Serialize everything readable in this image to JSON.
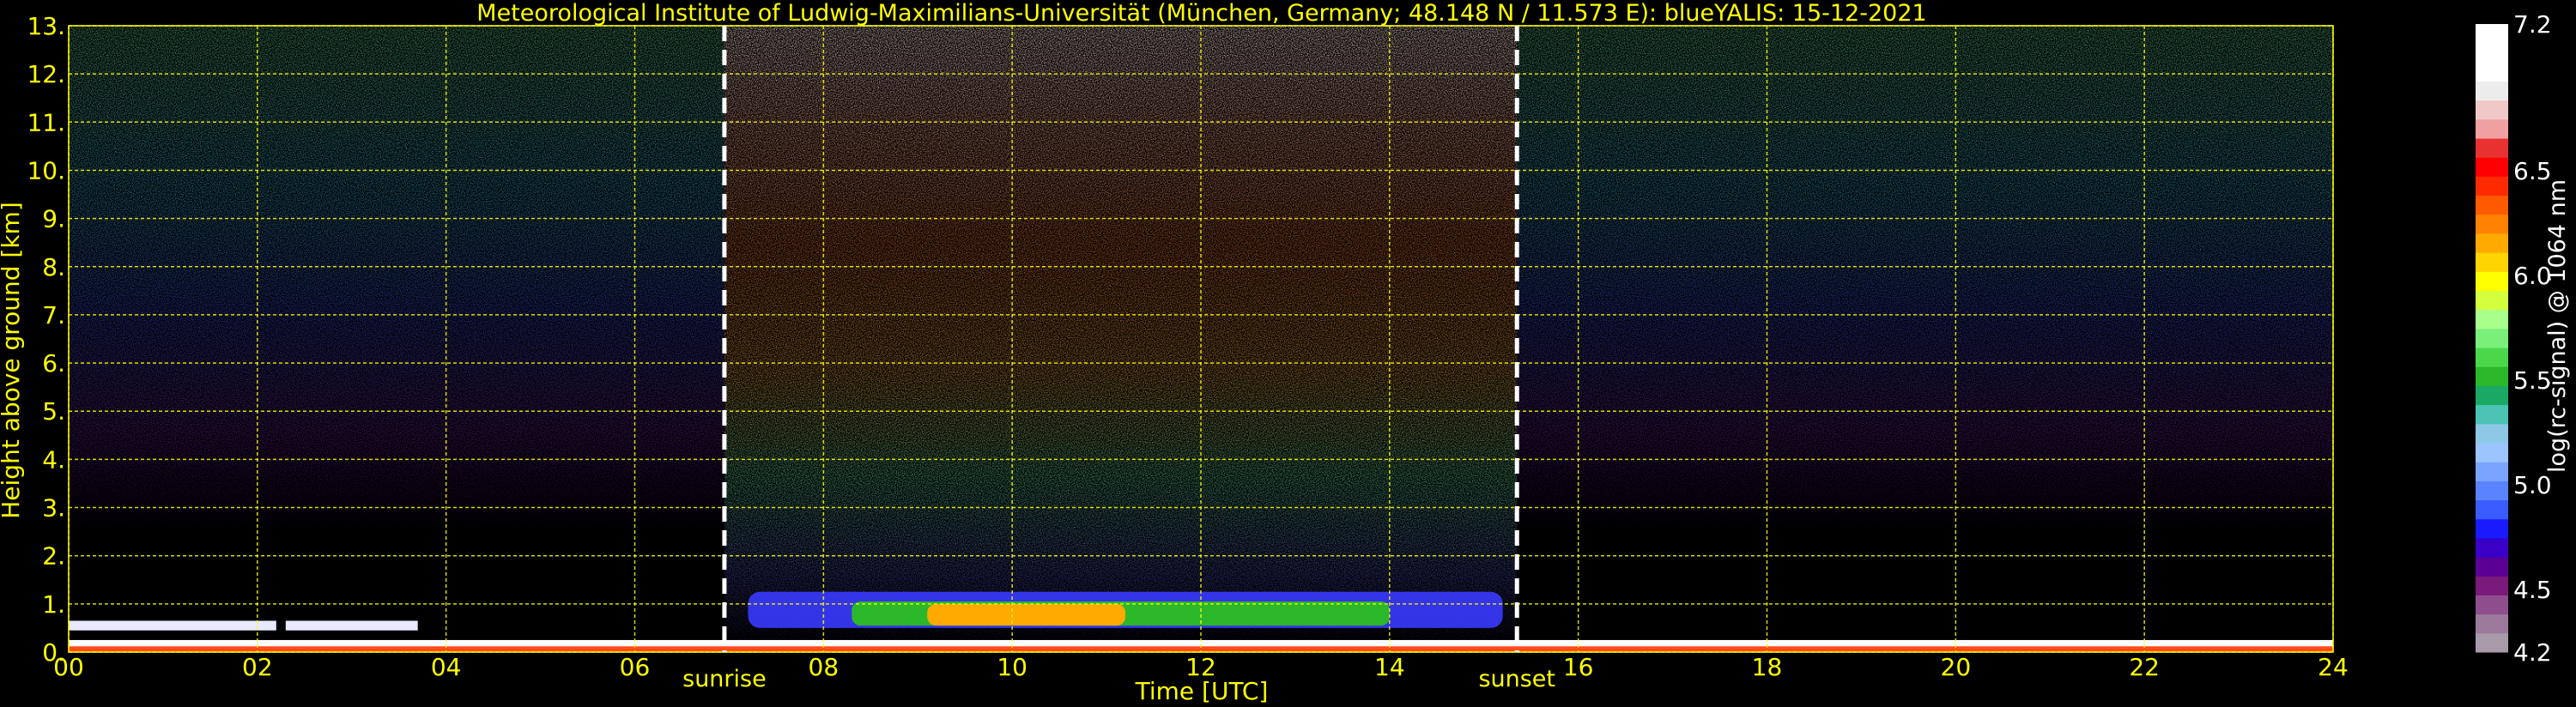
{
  "chart_data": {
    "type": "heatmap",
    "title": "Meteorological Institute of Ludwig-Maximilians-Universität (München, Germany; 48.148 N / 11.573 E):    blueYALIS: 15-12-2021",
    "xlabel": "Time [UTC]",
    "ylabel": "Height above ground [km]",
    "xlim": [
      0,
      24
    ],
    "ylim": [
      0,
      13
    ],
    "x_ticks": [
      "00",
      "02",
      "04",
      "06",
      "08",
      "10",
      "12",
      "14",
      "16",
      "18",
      "20",
      "22",
      "24"
    ],
    "y_ticks": [
      "0.",
      "1.",
      "2.",
      "3.",
      "4.",
      "5.",
      "6.",
      "7.",
      "8.",
      "9.",
      "10.",
      "11.",
      "12.",
      "13."
    ],
    "grid": true,
    "markers": [
      {
        "label": "sunrise",
        "x": 6.95
      },
      {
        "label": "sunset",
        "x": 15.35
      }
    ],
    "colorbar": {
      "label": "log(rc-signal) @ 1064 nm",
      "range": [
        4.2,
        7.2
      ],
      "ticks": [
        "7.2",
        "6.5",
        "6.0",
        "5.5",
        "5.0",
        "4.5",
        "4.2"
      ],
      "colors": [
        "#a89aa8",
        "#9c7a9c",
        "#8e4e8e",
        "#7a1a7a",
        "#5a0094",
        "#3a00c8",
        "#1a1aff",
        "#3a5cff",
        "#5a84ff",
        "#7aa4ff",
        "#9cc4ff",
        "#8cc8e6",
        "#4cc4b4",
        "#1aa864",
        "#2ab82a",
        "#4ad84a",
        "#7af07a",
        "#a8ff8c",
        "#d4ff3c",
        "#ffff00",
        "#ffd400",
        "#ffaa00",
        "#ff8200",
        "#ff5a00",
        "#ff2a00",
        "#ff0000",
        "#e83232",
        "#f0a0a0",
        "#f0c8c8",
        "#ececec",
        "#ffffff",
        "#ffffff",
        "#ffffff"
      ]
    }
  },
  "colors": {
    "text": "#ffff00",
    "grid": "#ffff00",
    "background": "#000000"
  }
}
